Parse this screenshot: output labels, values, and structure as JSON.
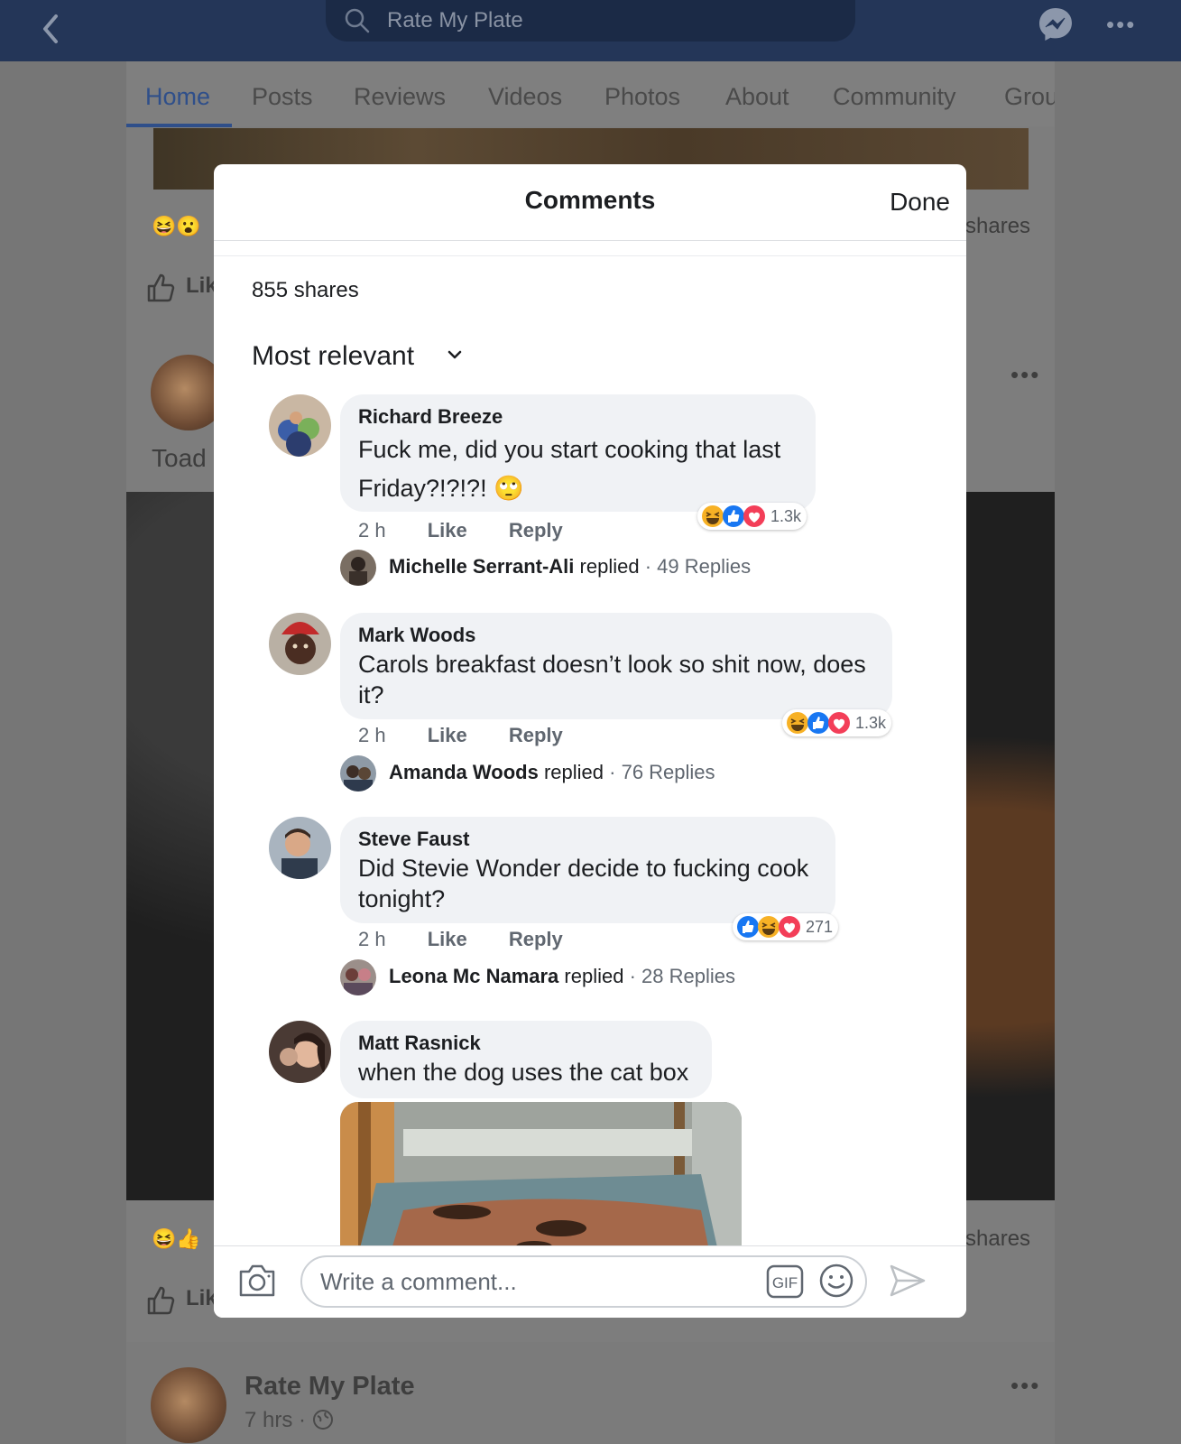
{
  "topbar": {
    "search_text": "Rate My Plate",
    "icons": [
      "back-arrow-icon",
      "search-icon",
      "messenger-icon",
      "more-dots-icon"
    ]
  },
  "tabs": [
    {
      "label": "Home",
      "active": true
    },
    {
      "label": "Posts"
    },
    {
      "label": "Reviews"
    },
    {
      "label": "Videos"
    },
    {
      "label": "Photos"
    },
    {
      "label": "About"
    },
    {
      "label": "Community"
    },
    {
      "label": "Grou"
    }
  ],
  "background": {
    "shares_1": "shares",
    "like_1": "Lik",
    "post_name_partial": "Toad",
    "shares_2": "shares",
    "like_2": "Lik",
    "bottom_post_title": "Rate My Plate",
    "bottom_post_meta": "7 hrs ·"
  },
  "modal": {
    "title": "Comments",
    "done_label": "Done",
    "shares": "855 shares",
    "sort_label": "Most relevant",
    "comments": [
      {
        "name": "Richard Breeze",
        "text": "Fuck me, did you start cooking that last Friday?!?!?! 🙄",
        "time": "2 h",
        "like": "Like",
        "reply": "Reply",
        "reaction_count": "1.3k",
        "replier": "Michelle Serrant-Ali",
        "replied_word": "replied",
        "replies": "49 Replies"
      },
      {
        "name": "Mark Woods",
        "text": "Carols breakfast doesn’t look so shit now, does it?",
        "time": "2 h",
        "like": "Like",
        "reply": "Reply",
        "reaction_count": "1.3k",
        "replier": "Amanda Woods",
        "replied_word": "replied",
        "replies": "76 Replies"
      },
      {
        "name": "Steve Faust",
        "text": "Did Stevie Wonder decide to fucking cook tonight?",
        "time": "2 h",
        "like": "Like",
        "reply": "Reply",
        "reaction_count": "271",
        "replier": "Leona Mc Namara",
        "replied_word": "replied",
        "replies": "28 Replies"
      },
      {
        "name": "Matt Rasnick",
        "text": "when the dog uses the cat box"
      }
    ],
    "composer": {
      "placeholder": "Write a comment...",
      "gif_label": "GIF"
    }
  },
  "colors": {
    "topbar": "#243658",
    "link_blue": "#1877f2",
    "like_blue": "#1877f2",
    "love_red": "#f33e58",
    "haha_yellow": "#f7b125"
  }
}
